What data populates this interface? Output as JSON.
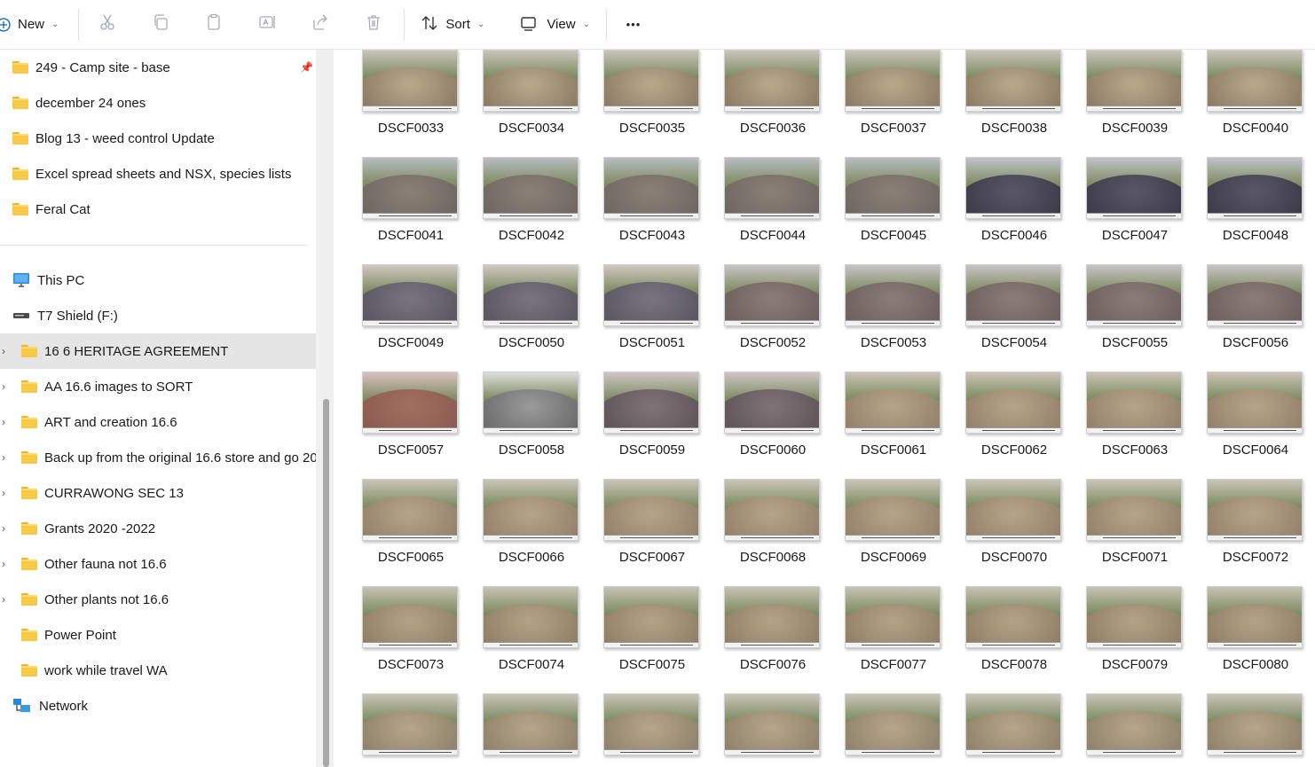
{
  "toolbar": {
    "new_label": "New",
    "sort_label": "Sort",
    "view_label": "View",
    "more_label": "•••"
  },
  "nav": {
    "quick_access": [
      {
        "label": "249 - Camp site - base",
        "pinned": true
      },
      {
        "label": "december 24 ones"
      },
      {
        "label": "Blog 13 - weed control Update"
      },
      {
        "label": "Excel spread sheets and NSX, species lists"
      },
      {
        "label": "Feral Cat"
      }
    ],
    "this_pc": "This PC",
    "drive": "T7 Shield (F:)",
    "drive_folders": [
      {
        "label": "16 6 HERITAGE AGREEMENT",
        "selected": true,
        "expandable": true
      },
      {
        "label": "AA 16.6 images to SORT",
        "expandable": true
      },
      {
        "label": "ART and creation 16.6",
        "expandable": true
      },
      {
        "label": "Back up from the original 16.6 store and go 20",
        "expandable": true
      },
      {
        "label": "CURRAWONG SEC 13",
        "expandable": true
      },
      {
        "label": "Grants 2020 -2022",
        "expandable": true
      },
      {
        "label": "Other fauna not 16.6",
        "expandable": true
      },
      {
        "label": "Other plants not 16.6",
        "expandable": true
      },
      {
        "label": "Power Point",
        "expandable": false
      },
      {
        "label": "work while travel WA",
        "expandable": false
      }
    ],
    "network": "Network"
  },
  "files": [
    [
      "DSCF0033",
      "DSCF0034",
      "DSCF0035",
      "DSCF0036",
      "DSCF0037",
      "DSCF0038",
      "DSCF0039",
      "DSCF0040"
    ],
    [
      "DSCF0041",
      "DSCF0042",
      "DSCF0043",
      "DSCF0044",
      "DSCF0045",
      "DSCF0046",
      "DSCF0047",
      "DSCF0048"
    ],
    [
      "DSCF0049",
      "DSCF0050",
      "DSCF0051",
      "DSCF0052",
      "DSCF0053",
      "DSCF0054",
      "DSCF0055",
      "DSCF0056"
    ],
    [
      "DSCF0057",
      "DSCF0058",
      "DSCF0059",
      "DSCF0060",
      "DSCF0061",
      "DSCF0062",
      "DSCF0063",
      "DSCF0064"
    ],
    [
      "DSCF0065",
      "DSCF0066",
      "DSCF0067",
      "DSCF0068",
      "DSCF0069",
      "DSCF0070",
      "DSCF0071",
      "DSCF0072"
    ],
    [
      "DSCF0073",
      "DSCF0074",
      "DSCF0075",
      "DSCF0076",
      "DSCF0077",
      "DSCF0078",
      "DSCF0079",
      "DSCF0080"
    ],
    [
      "",
      "",
      "",
      "",
      "",
      "",
      "",
      ""
    ]
  ],
  "colors": {
    "accent": "#0067c0",
    "folder": "#f7c948",
    "selected_bg": "#e5e5e5"
  }
}
